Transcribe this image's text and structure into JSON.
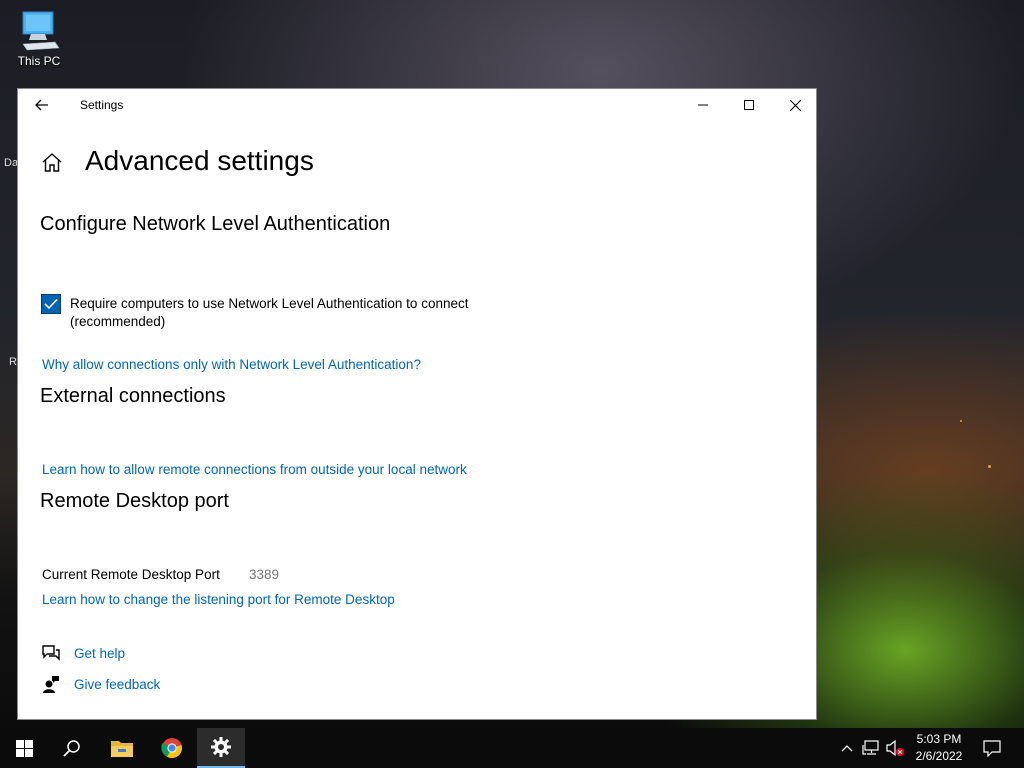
{
  "desktop": {
    "icon_label": "This PC",
    "edge_fragments": [
      "Da",
      "R"
    ]
  },
  "window": {
    "title": "Settings",
    "page_title": "Advanced settings",
    "nla": {
      "heading": "Configure Network Level Authentication",
      "checkbox_checked": true,
      "checkbox_label_line1": "Require computers to use Network Level Authentication to connect",
      "checkbox_label_line2": "(recommended)",
      "link": "Why allow connections only with Network Level Authentication?"
    },
    "external": {
      "heading": "External connections",
      "link": "Learn how to allow remote connections from outside your local network"
    },
    "port": {
      "heading": "Remote Desktop port",
      "label": "Current Remote Desktop Port",
      "value": "3389",
      "link": "Learn how to change the listening port for Remote Desktop"
    },
    "help": {
      "get_help": "Get help",
      "give_feedback": "Give feedback"
    }
  },
  "taskbar": {
    "apps": [
      "start-icon",
      "search-icon",
      "file-explorer-icon",
      "chrome-icon",
      "settings-icon"
    ],
    "active_app": "settings-icon",
    "time": "5:03 PM",
    "date": "2/6/2022"
  },
  "colors": {
    "accent": "#0063b1",
    "link": "#0067b8",
    "taskbar": "#0b0b0b"
  }
}
